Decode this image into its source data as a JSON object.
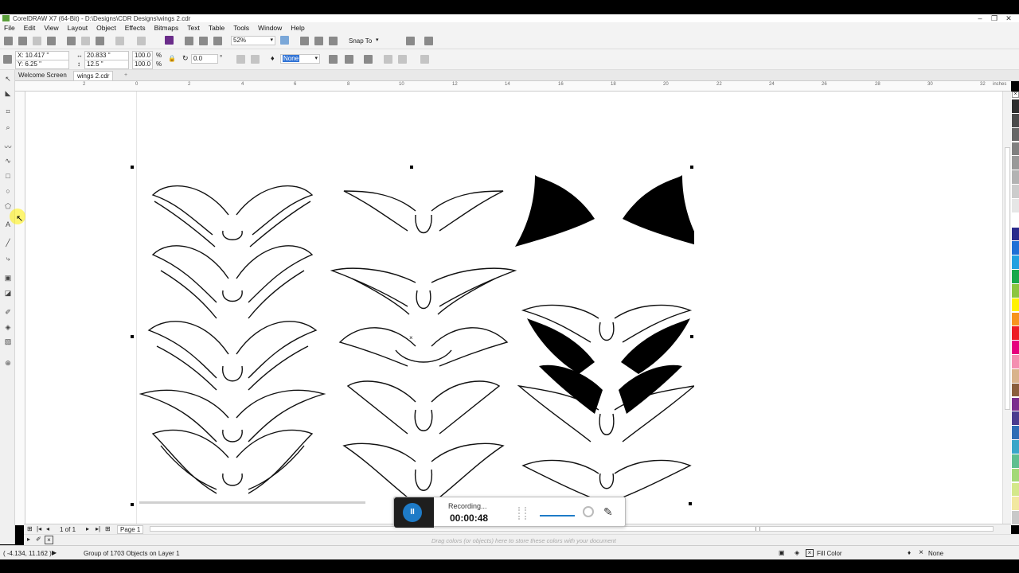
{
  "window": {
    "title": "CorelDRAW X7 (64-Bit) - D:\\Designs\\CDR Designs\\wings 2.cdr",
    "min": "–",
    "max": "❐",
    "close": "✕"
  },
  "menu": [
    "File",
    "Edit",
    "View",
    "Layout",
    "Object",
    "Effects",
    "Bitmaps",
    "Text",
    "Table",
    "Tools",
    "Window",
    "Help"
  ],
  "toolbar": {
    "zoom_value": "52%",
    "snap_to_label": "Snap To"
  },
  "propertybar": {
    "x": "X: 10.417 \"",
    "y": "Y: 6.25 \"",
    "width": "20.833 \"",
    "height": "12.5 \"",
    "scale_w": "100.0",
    "scale_h": "100.0",
    "percent": "%",
    "rotation": "0.0",
    "degree": "°",
    "outline": "None"
  },
  "tabs": {
    "welcome": "Welcome Screen",
    "document": "wings 2.cdr",
    "add": "+"
  },
  "ruler": {
    "h": [
      "2",
      "0",
      "2",
      "4",
      "6",
      "8",
      "10",
      "12",
      "14",
      "16",
      "18",
      "20",
      "22",
      "24",
      "26",
      "28",
      "30",
      "32"
    ],
    "units": "inches"
  },
  "docnav": {
    "page_count": "1 of 1",
    "page_tab": "Page 1"
  },
  "colortray": {
    "hint": "Drag colors (or objects) here to store these colors with your document"
  },
  "status": {
    "coords": "( -4.134, 11.162 )",
    "selection": "Group of 1703 Objects on Layer 1",
    "fill_label": "Fill Color",
    "outline_label": "None"
  },
  "recorder": {
    "status": "Recording...",
    "time": "00:00:48",
    "pause_icon": "II",
    "pen_icon": "✎"
  },
  "palette_colors": [
    "#2e2e2e",
    "#4a4a4a",
    "#666666",
    "#808080",
    "#999999",
    "#b3b3b3",
    "#cccccc",
    "#e6e6e6",
    "#ffffff",
    "#2b2b8c",
    "#1f6fd6",
    "#22a0e0",
    "#17a84a",
    "#8cc63f",
    "#fff200",
    "#f7941d",
    "#ed1c24",
    "#e6007e",
    "#f48fb1",
    "#d9b38c",
    "#8b5e3c",
    "#7b2d8e",
    "#4b3b8f",
    "#2f6db5",
    "#3aa6c9",
    "#5fbf8f",
    "#a3d977",
    "#d4e88a",
    "#f2e8a0",
    "#c9c9c9"
  ]
}
